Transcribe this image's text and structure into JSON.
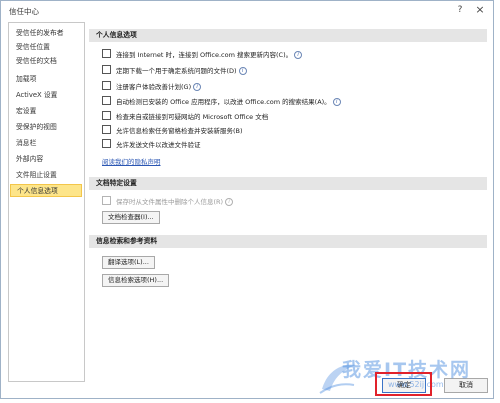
{
  "dialog": {
    "title": "信任中心",
    "help_icon": "question-mark-icon",
    "close_icon": "close-x-icon"
  },
  "sidebar": {
    "items": [
      {
        "label": "受信任的发布者",
        "selected": false
      },
      {
        "label": "受信任位置",
        "selected": false
      },
      {
        "label": "受信任的文档",
        "selected": false
      },
      {
        "label": "加载项",
        "selected": false
      },
      {
        "label": "ActiveX 设置",
        "selected": false
      },
      {
        "label": "宏设置",
        "selected": false
      },
      {
        "label": "受保护的视图",
        "selected": false
      },
      {
        "label": "消息栏",
        "selected": false
      },
      {
        "label": "外部内容",
        "selected": false
      },
      {
        "label": "文件阻止设置",
        "selected": false
      },
      {
        "label": "个人信息选项",
        "selected": true
      }
    ]
  },
  "personal": {
    "header": "个人信息选项",
    "options": [
      {
        "label": "连接到 Internet 时，连接到 Office.com 搜索更新内容(C)。",
        "checked": false,
        "info": true
      },
      {
        "label": "定期下载一个用于确定系统问题的文件(D)",
        "checked": false,
        "info": true
      },
      {
        "label": "注册客户体验改善计划(G)",
        "checked": false,
        "info": true
      },
      {
        "label": "自动检测已安装的 Office 应用程序，以改进 Office.com 的搜索结果(A)。",
        "checked": false,
        "info": true
      },
      {
        "label": "检查来自或链接到可疑网站的 Microsoft Office 文档",
        "checked": false,
        "info": false
      },
      {
        "label": "允许信息检索任务窗格检查并安装新服务(B)",
        "checked": false,
        "info": false
      },
      {
        "label": "允许发送文件以改进文件验证",
        "checked": false,
        "info": false
      }
    ],
    "privacy_link": "阅读我们的隐私声明"
  },
  "document": {
    "header": "文档特定设置",
    "option": {
      "label": "保存时从文件属性中删除个人信息(R)",
      "checked": false,
      "disabled": true,
      "info": true
    },
    "inspector_button": "文档检查器(I)..."
  },
  "research": {
    "header": "信息检索和参考资料",
    "translation_button": "翻译选项(L)...",
    "research_button": "信息检索选项(H)..."
  },
  "footer": {
    "ok_label": "确定",
    "cancel_label": "取消"
  },
  "watermark": {
    "text": "我爱IT技术网",
    "url": "www.52ij.com"
  },
  "colors": {
    "selected_bg": "#fde58a",
    "section_header_bg": "#e5e5e5",
    "link": "#2a56b3",
    "highlight_box": "#e1222b"
  }
}
